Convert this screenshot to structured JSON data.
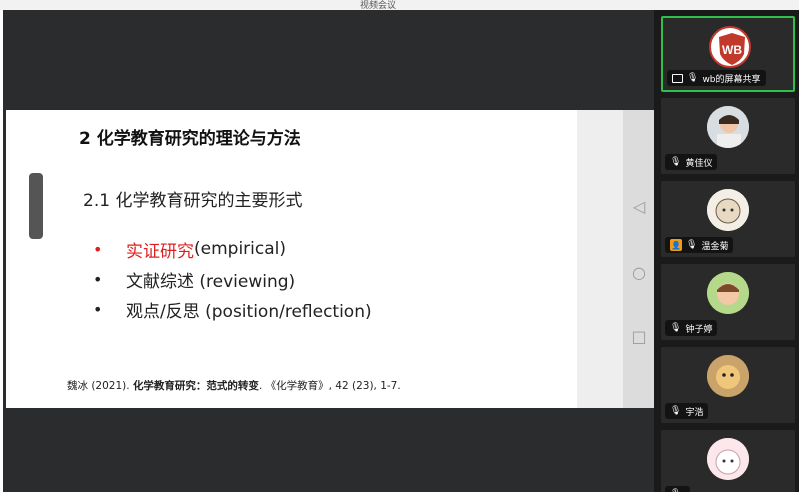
{
  "window": {
    "title": "视频会议"
  },
  "slide": {
    "title": "2 化学教育研究的理论与方法",
    "subtitle": "2.1 化学教育研究的主要形式",
    "bullets": [
      {
        "highlight": "实证研究",
        "text": "(empirical)"
      },
      {
        "highlight": "",
        "text": "文献综述 (reviewing)"
      },
      {
        "highlight": "",
        "text": "观点/反思 (position/reflection)"
      }
    ],
    "reference": {
      "prefix": "魏冰 (2021). ",
      "title": "化学教育研究：范式的转变",
      "suffix": ". 《化学教育》, 42 (23), 1-7."
    }
  },
  "nav": {
    "back_icon": "◁",
    "home_icon": "○",
    "recent_icon": "□"
  },
  "participants": [
    {
      "name": "wb的屏幕共享",
      "avatar_icon": "wb-logo-icon",
      "active": true
    },
    {
      "name": "黄佳仪",
      "avatar_icon": "child-photo-avatar"
    },
    {
      "name": "温金菊",
      "avatar_icon": "cartoon-avatar"
    },
    {
      "name": "钟子婷",
      "avatar_icon": "child-photo-avatar"
    },
    {
      "name": "宇浩",
      "avatar_icon": "toy-avatar"
    },
    {
      "name": "",
      "avatar_icon": "hamster-avatar"
    }
  ],
  "colors": {
    "accent_red": "#e02020",
    "active_border": "#2fbf4a"
  }
}
